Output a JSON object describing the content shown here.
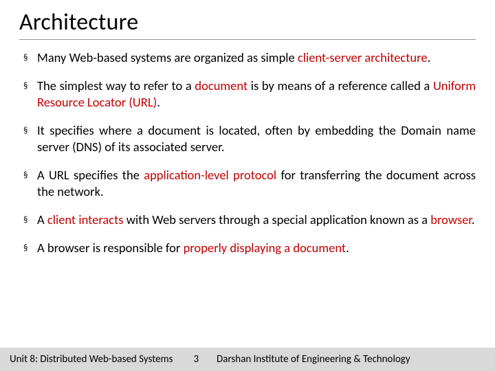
{
  "title": "Architecture",
  "bullets": [
    {
      "pre": "Many Web-based systems are organized as simple ",
      "hl": "client-server architecture",
      "post": "."
    },
    {
      "pre": "The simplest way to refer to a ",
      "hl": "document",
      "post": " is by means of a reference called a ",
      "hl2": "Uniform Resource Locator (URL)",
      "post2": "."
    },
    {
      "pre": "It specifies where a document is located, often by embedding the Domain name server (DNS) of its associated server.",
      "hl": "",
      "post": ""
    },
    {
      "pre": "A URL specifies the ",
      "hl": "application-level protocol",
      "post": " for transferring the document across the network."
    },
    {
      "pre": "A ",
      "hl": "client interacts",
      "post": " with Web servers through a special application known as a ",
      "hl2": "browser",
      "post2": "."
    },
    {
      "pre": "A browser is responsible for ",
      "hl": "properly displaying a document",
      "post": "."
    }
  ],
  "footer": {
    "left": "Unit 8: Distributed Web-based Systems",
    "num": "3",
    "right": "Darshan Institute of Engineering & Technology"
  }
}
